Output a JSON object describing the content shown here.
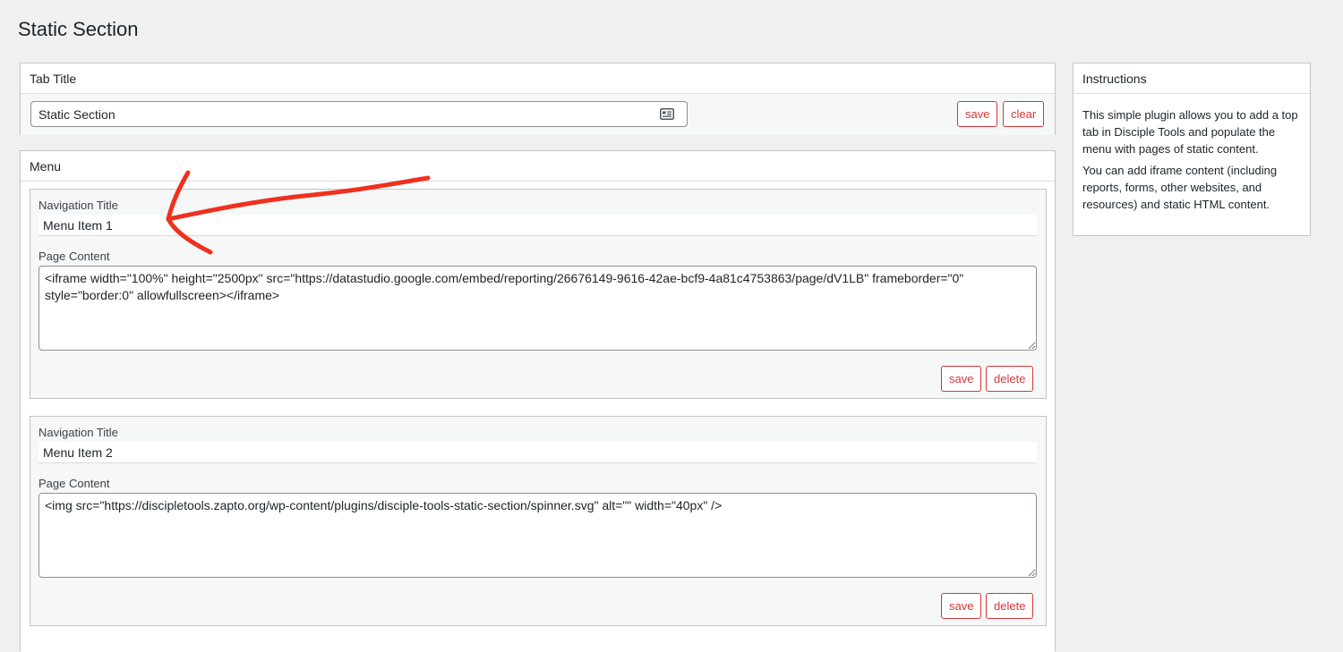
{
  "page": {
    "title": "Static Section"
  },
  "tab_title": {
    "header": "Tab Title",
    "input_value": "Static Section",
    "save_label": "save",
    "clear_label": "clear"
  },
  "menu": {
    "header": "Menu",
    "items": [
      {
        "nav_label": "Navigation Title",
        "nav_value": "Menu Item 1",
        "content_label": "Page Content",
        "content_value": "<iframe width=\"100%\" height=\"2500px\" src=\"https://datastudio.google.com/embed/reporting/26676149-9616-42ae-bcf9-4a81c4753863/page/dV1LB\" frameborder=\"0\" style=\"border:0\" allowfullscreen></iframe>",
        "save_label": "save",
        "delete_label": "delete"
      },
      {
        "nav_label": "Navigation Title",
        "nav_value": "Menu Item 2",
        "content_label": "Page Content",
        "content_value": "<img src=\"https://discipletools.zapto.org/wp-content/plugins/disciple-tools-static-section/spinner.svg\" alt=\"\" width=\"40px\" />",
        "save_label": "save",
        "delete_label": "delete"
      }
    ]
  },
  "instructions": {
    "header": "Instructions",
    "paragraph1": "This simple plugin allows you to add a top tab in Disciple Tools and populate the menu with pages of static content.",
    "paragraph2": "You can add iframe content (including reports, forms, other websites, and resources) and static HTML content."
  },
  "colors": {
    "accent_red": "#d63638",
    "annotation_red": "#f0301e",
    "background": "#f0f0f1"
  },
  "icons": {
    "title_input": "contact-card-icon"
  }
}
